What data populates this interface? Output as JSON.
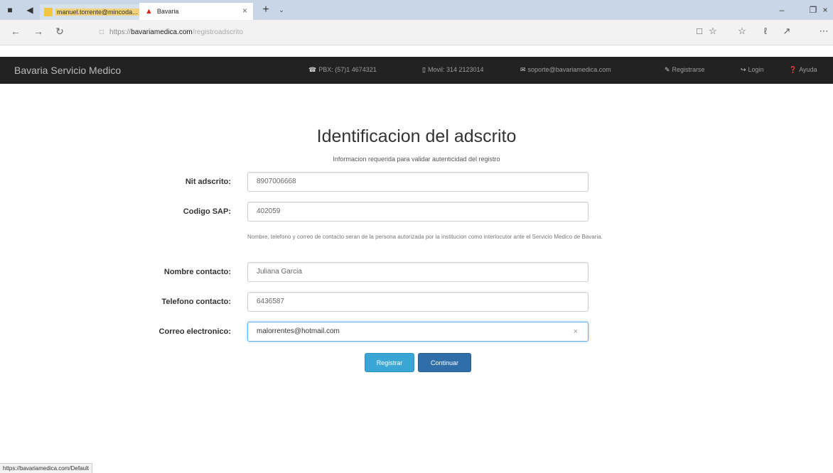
{
  "browser": {
    "tabs": [
      {
        "label": "manuel.torrente@mincoda..."
      },
      {
        "label": "Bavaria"
      }
    ],
    "url_scheme": "https://",
    "url_host": "bavariamedica.com",
    "url_path": "/registroadscrito",
    "status_url": "https://bavariamedica.com/Default"
  },
  "navbar": {
    "brand": "Bavaria Servicio Medico",
    "pbx": "PBX: (57)1 4674321",
    "movil": "Movil: 314 2123014",
    "email": "soporte@bavariamedica.com",
    "register": "Registrarse",
    "login": "Login",
    "help": "Ayuda"
  },
  "main": {
    "title": "Identificacion del adscrito",
    "subtitle": "Informacion requerida para validar autenticidad del registro",
    "note": "Nombre, telefono y correo de contacto seran de la persona autorizada por la institucion como interlocutor ante el Servicio Medico de Bavaria.",
    "fields": {
      "nit": {
        "label": "Nit adscrito:",
        "value": "8907006668"
      },
      "sap": {
        "label": "Codigo SAP:",
        "value": "402059"
      },
      "nombre": {
        "label": "Nombre contacto:",
        "value": "Juliana Garcia"
      },
      "telefono": {
        "label": "Telefono contacto:",
        "value": "6436587"
      },
      "correo": {
        "label": "Correo electronico:",
        "value": "malorrentes@hotmail.com"
      }
    },
    "buttons": {
      "register": "Registrar",
      "continue": "Continuar"
    }
  }
}
